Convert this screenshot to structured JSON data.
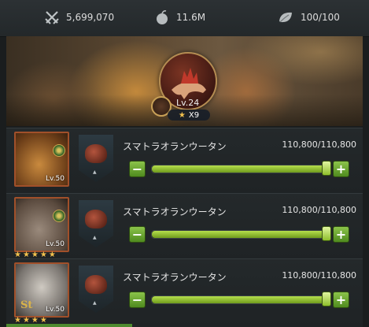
{
  "resources": {
    "power": "5,699,070",
    "food": "11.6M",
    "stamina": "100/100"
  },
  "icons": {
    "power": "crossed-swords-icon",
    "food": "apple-icon",
    "stamina": "leaf-icon"
  },
  "hero": {
    "level": "Lv.24",
    "stars": "X9"
  },
  "troops": [
    {
      "name": "スマトラオランウータン",
      "count": "110,800/110,800",
      "commander_level": "Lv.50",
      "stars": "",
      "rank_mark": "",
      "slider_fraction": 1.0
    },
    {
      "name": "スマトラオランウータン",
      "count": "110,800/110,800",
      "commander_level": "Lv.50",
      "stars": "★★★★★",
      "rank_mark": "",
      "slider_fraction": 1.0
    },
    {
      "name": "スマトラオランウータン",
      "count": "110,800/110,800",
      "commander_level": "Lv.50",
      "stars": "★★★★",
      "rank_mark": "St",
      "slider_fraction": 1.0
    }
  ],
  "buttons": {
    "minus": "−",
    "plus": "+"
  },
  "colors": {
    "accent_green": "#8bc34a",
    "star_gold": "#f2c14e"
  }
}
